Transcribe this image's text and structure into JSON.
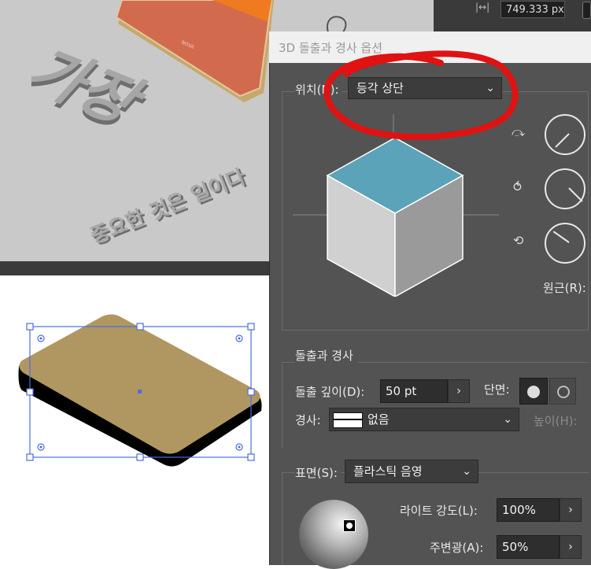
{
  "toolbar": {
    "width_value": "749.333 px"
  },
  "dialog": {
    "title": "3D 돌출과 경사 옵션",
    "position": {
      "label": "위치(N):",
      "value": "등각 상단"
    },
    "perspective_label": "원근(R):",
    "extrude_section": {
      "heading": "돌출과 경사",
      "depth_label": "돌출 깊이(D):",
      "depth_value": "50 pt",
      "cap_label": "단면:",
      "bevel_label": "경사:",
      "bevel_value": "없음",
      "height_label": "높이(H):"
    },
    "surface_section": {
      "surface_label": "표면(S):",
      "surface_value": "플라스틱 음영",
      "light_intensity_label": "라이트 강도(L):",
      "light_intensity_value": "100%",
      "ambient_label": "주변광(A):",
      "ambient_value": "50%"
    }
  },
  "canvas": {
    "artwork_top_text": "가장",
    "artwork_sub_text": "중요한 것은 일이다"
  },
  "colors": {
    "cube_top": "#5aa3b8",
    "annotation_red": "#e01212",
    "shape_fill": "#b09761"
  }
}
